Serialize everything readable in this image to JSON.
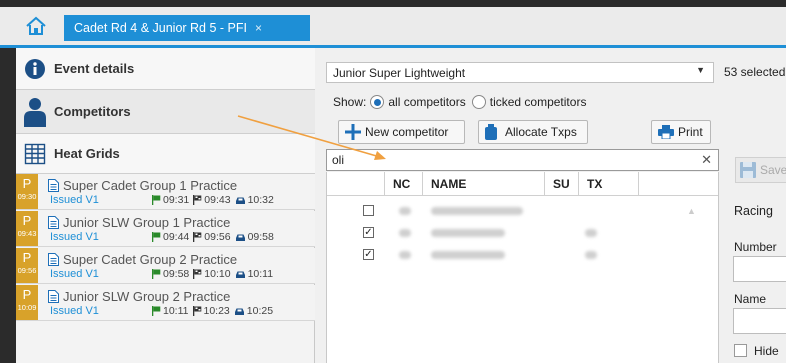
{
  "tab": {
    "title": "Cadet Rd 4 & Junior Rd 5 - PFI",
    "close": "×"
  },
  "nav": [
    {
      "label": "Event details",
      "icon": "info-icon"
    },
    {
      "label": "Competitors",
      "icon": "person-icon"
    },
    {
      "label": "Heat Grids",
      "icon": "grid-icon"
    }
  ],
  "heats": [
    {
      "badge": "P",
      "time": "09:30",
      "title": "Super Cadet Group 1 Practice",
      "status": "Issued V1",
      "t1": "09:31",
      "t2": "09:43",
      "t3": "10:32"
    },
    {
      "badge": "P",
      "time": "09:43",
      "title": "Junior SLW Group 1 Practice",
      "status": "Issued V1",
      "t1": "09:44",
      "t2": "09:56",
      "t3": "09:58"
    },
    {
      "badge": "P",
      "time": "09:56",
      "title": "Super Cadet Group 2 Practice",
      "status": "Issued V1",
      "t1": "09:58",
      "t2": "10:10",
      "t3": "10:11"
    },
    {
      "badge": "P",
      "time": "10:09",
      "title": "Junior SLW Group 2 Practice",
      "status": "Issued V1",
      "t1": "10:11",
      "t2": "10:23",
      "t3": "10:25"
    }
  ],
  "category": {
    "value": "Junior Super Lightweight",
    "selected_count": "53 selected"
  },
  "show": {
    "label": "Show:",
    "opt_all": "all competitors",
    "opt_ticked": "ticked competitors",
    "selected": "all"
  },
  "buttons": {
    "new_competitor": "New competitor",
    "allocate": "Allocate Txps",
    "print": "Print"
  },
  "search": {
    "value": "oli",
    "clear": "✕"
  },
  "grid": {
    "headers": [
      "NC",
      "NAME",
      "SU",
      "TX"
    ],
    "rows": [
      {
        "checked": false,
        "check_mark": ""
      },
      {
        "checked": true,
        "check_mark": "✓"
      },
      {
        "checked": true,
        "check_mark": "✓"
      }
    ]
  },
  "side": {
    "save": "Save",
    "racing": "Racing",
    "number": "Number",
    "name": "Name",
    "hide": "Hide"
  },
  "colors": {
    "accent": "#1e8fd6",
    "badge": "#d8a22a",
    "arrow": "#f0a040"
  }
}
